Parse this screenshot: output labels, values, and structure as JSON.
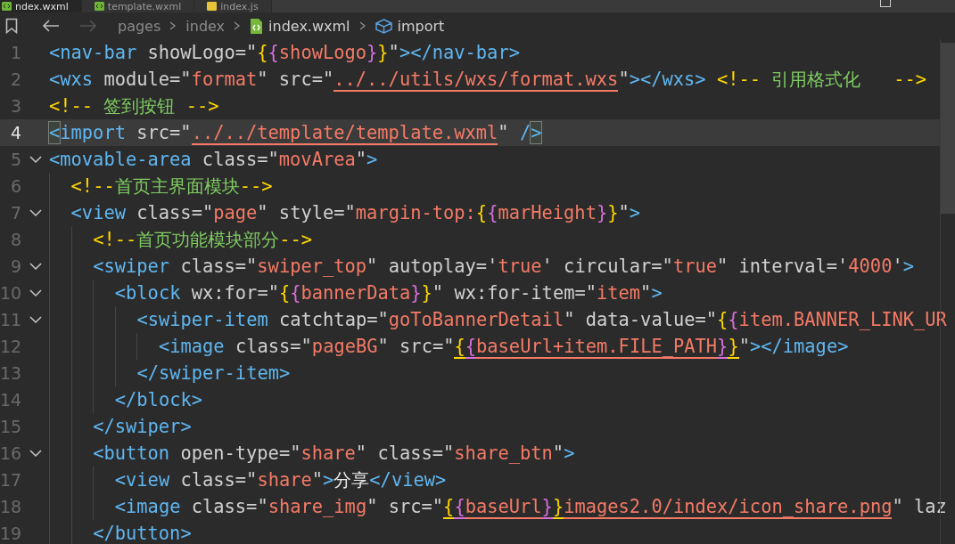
{
  "tabs": [
    {
      "label": "ndex.wxml",
      "kind": "wxml",
      "selected": true
    },
    {
      "label": "template.wxml",
      "kind": "wxml",
      "selected": false
    },
    {
      "label": "index.js",
      "kind": "js",
      "selected": false
    }
  ],
  "breadcrumb": {
    "back_disabled": false,
    "forward_disabled": true,
    "items": [
      {
        "label": "pages",
        "kind": "folder"
      },
      {
        "label": "index",
        "kind": "folder"
      },
      {
        "label": "index.wxml",
        "kind": "file"
      },
      {
        "label": "import",
        "kind": "symbol"
      }
    ]
  },
  "lines": [
    {
      "number": "1",
      "foldable": false,
      "selected": false,
      "tokens": [
        {
          "kind": "tag",
          "text": "<nav-bar"
        },
        {
          "kind": "attr",
          "text": " showLogo=\""
        },
        {
          "kind": "brace1",
          "text": "{"
        },
        {
          "kind": "brace2",
          "text": "{"
        },
        {
          "kind": "string",
          "text": "showLogo"
        },
        {
          "kind": "brace2",
          "text": "}"
        },
        {
          "kind": "brace1",
          "text": "}"
        },
        {
          "kind": "attr",
          "text": "\""
        },
        {
          "kind": "tag",
          "text": "></nav-bar>"
        }
      ]
    },
    {
      "number": "2",
      "foldable": false,
      "selected": false,
      "tokens": [
        {
          "kind": "tag",
          "text": "<wxs"
        },
        {
          "kind": "attr",
          "text": " module=\""
        },
        {
          "kind": "string",
          "text": "format"
        },
        {
          "kind": "attr",
          "text": "\" src=\""
        },
        {
          "kind": "string",
          "text": "../../utils/wxs/format.wxs",
          "underlined": true
        },
        {
          "kind": "attr",
          "text": "\""
        },
        {
          "kind": "tag",
          "text": "></wxs> "
        },
        {
          "kind": "comment_mark",
          "text": "<!--"
        },
        {
          "kind": "comment",
          "text": " 引用格式化   "
        },
        {
          "kind": "comment_mark",
          "text": "-->"
        }
      ]
    },
    {
      "number": "3",
      "foldable": false,
      "selected": false,
      "tokens": [
        {
          "kind": "comment_mark",
          "text": "<!--"
        },
        {
          "kind": "comment",
          "text": " 签到按钮 "
        },
        {
          "kind": "comment_mark",
          "text": "-->"
        }
      ]
    },
    {
      "number": "4",
      "foldable": false,
      "selected": true,
      "tokens": [
        {
          "kind": "tag",
          "text": "<",
          "matched": true
        },
        {
          "kind": "tag",
          "text": "import"
        },
        {
          "kind": "attr",
          "text": " src=\""
        },
        {
          "kind": "string",
          "text": "../../template/template.wxml",
          "underlined": true
        },
        {
          "kind": "attr",
          "text": "\" "
        },
        {
          "kind": "tag",
          "text": "/"
        },
        {
          "kind": "tag",
          "text": ">",
          "matched": true
        }
      ]
    },
    {
      "number": "5",
      "foldable": true,
      "selected": false,
      "tokens": [
        {
          "kind": "tag",
          "text": "<movable-area"
        },
        {
          "kind": "attr",
          "text": " class=\""
        },
        {
          "kind": "string",
          "text": "movArea"
        },
        {
          "kind": "attr",
          "text": "\""
        },
        {
          "kind": "tag",
          "text": ">"
        }
      ]
    },
    {
      "number": "6",
      "foldable": false,
      "selected": false,
      "tokens": [
        {
          "kind": "comment_mark",
          "text": "  <!--"
        },
        {
          "kind": "comment",
          "text": "首页主界面模块"
        },
        {
          "kind": "comment_mark",
          "text": "-->"
        }
      ]
    },
    {
      "number": "7",
      "foldable": true,
      "selected": false,
      "tokens": [
        {
          "kind": "tag",
          "text": "  <view"
        },
        {
          "kind": "attr",
          "text": " class=\""
        },
        {
          "kind": "string",
          "text": "page"
        },
        {
          "kind": "attr",
          "text": "\" style=\""
        },
        {
          "kind": "string",
          "text": "margin-top:"
        },
        {
          "kind": "brace1",
          "text": "{"
        },
        {
          "kind": "brace2",
          "text": "{"
        },
        {
          "kind": "string",
          "text": "marHeight"
        },
        {
          "kind": "brace2",
          "text": "}"
        },
        {
          "kind": "brace1",
          "text": "}"
        },
        {
          "kind": "attr",
          "text": "\""
        },
        {
          "kind": "tag",
          "text": ">"
        }
      ]
    },
    {
      "number": "8",
      "foldable": false,
      "selected": false,
      "tokens": [
        {
          "kind": "comment_mark",
          "text": "    <!--"
        },
        {
          "kind": "comment",
          "text": "首页功能模块部分"
        },
        {
          "kind": "comment_mark",
          "text": "-->"
        }
      ]
    },
    {
      "number": "9",
      "foldable": true,
      "selected": false,
      "tokens": [
        {
          "kind": "tag",
          "text": "    <swiper"
        },
        {
          "kind": "attr",
          "text": " class=\""
        },
        {
          "kind": "string",
          "text": "swiper_top"
        },
        {
          "kind": "attr",
          "text": "\" autoplay='"
        },
        {
          "kind": "string",
          "text": "true"
        },
        {
          "kind": "attr",
          "text": "' circular=\""
        },
        {
          "kind": "string",
          "text": "true"
        },
        {
          "kind": "attr",
          "text": "\" interval='"
        },
        {
          "kind": "string",
          "text": "4000"
        },
        {
          "kind": "attr",
          "text": "'"
        },
        {
          "kind": "tag",
          "text": ">"
        }
      ]
    },
    {
      "number": "10",
      "foldable": true,
      "selected": false,
      "tokens": [
        {
          "kind": "tag",
          "text": "      <block"
        },
        {
          "kind": "attr",
          "text": " wx:for=\""
        },
        {
          "kind": "brace1",
          "text": "{"
        },
        {
          "kind": "brace2",
          "text": "{"
        },
        {
          "kind": "string",
          "text": "bannerData"
        },
        {
          "kind": "brace2",
          "text": "}"
        },
        {
          "kind": "brace1",
          "text": "}"
        },
        {
          "kind": "attr",
          "text": "\" wx:for-item=\""
        },
        {
          "kind": "string",
          "text": "item"
        },
        {
          "kind": "attr",
          "text": "\""
        },
        {
          "kind": "tag",
          "text": ">"
        }
      ]
    },
    {
      "number": "11",
      "foldable": true,
      "selected": false,
      "tokens": [
        {
          "kind": "tag",
          "text": "        <swiper-item"
        },
        {
          "kind": "attr",
          "text": " catchtap=\""
        },
        {
          "kind": "string",
          "text": "goToBannerDetail"
        },
        {
          "kind": "attr",
          "text": "\" data-value=\""
        },
        {
          "kind": "brace1",
          "text": "{"
        },
        {
          "kind": "brace2",
          "text": "{"
        },
        {
          "kind": "string",
          "text": "item.BANNER_LINK_UR"
        }
      ]
    },
    {
      "number": "12",
      "foldable": false,
      "selected": false,
      "tokens": [
        {
          "kind": "tag",
          "text": "          <image"
        },
        {
          "kind": "attr",
          "text": " class=\""
        },
        {
          "kind": "string",
          "text": "pageBG"
        },
        {
          "kind": "attr",
          "text": "\" src=\""
        },
        {
          "kind": "brace1",
          "text": "{",
          "underlined": true
        },
        {
          "kind": "brace2",
          "text": "{",
          "underlined": true
        },
        {
          "kind": "string",
          "text": "baseUrl+item.FILE_PATH",
          "underlined": true
        },
        {
          "kind": "brace2",
          "text": "}",
          "underlined": true
        },
        {
          "kind": "brace1",
          "text": "}",
          "underlined": true
        },
        {
          "kind": "attr",
          "text": "\""
        },
        {
          "kind": "tag",
          "text": "></image>"
        }
      ]
    },
    {
      "number": "13",
      "foldable": false,
      "selected": false,
      "tokens": [
        {
          "kind": "tag",
          "text": "        </swiper-item>"
        }
      ]
    },
    {
      "number": "14",
      "foldable": false,
      "selected": false,
      "tokens": [
        {
          "kind": "tag",
          "text": "      </block>"
        }
      ]
    },
    {
      "number": "15",
      "foldable": false,
      "selected": false,
      "tokens": [
        {
          "kind": "tag",
          "text": "    </swiper>"
        }
      ]
    },
    {
      "number": "16",
      "foldable": true,
      "selected": false,
      "tokens": [
        {
          "kind": "tag",
          "text": "    <button"
        },
        {
          "kind": "attr",
          "text": " open-type=\""
        },
        {
          "kind": "string",
          "text": "share"
        },
        {
          "kind": "attr",
          "text": "\" class=\""
        },
        {
          "kind": "string",
          "text": "share_btn"
        },
        {
          "kind": "attr",
          "text": "\""
        },
        {
          "kind": "tag",
          "text": ">"
        }
      ]
    },
    {
      "number": "17",
      "foldable": false,
      "selected": false,
      "tokens": [
        {
          "kind": "tag",
          "text": "      <view"
        },
        {
          "kind": "attr",
          "text": " class=\""
        },
        {
          "kind": "string",
          "text": "share"
        },
        {
          "kind": "attr",
          "text": "\""
        },
        {
          "kind": "tag",
          "text": ">"
        },
        {
          "kind": "plain",
          "text": "分享"
        },
        {
          "kind": "tag",
          "text": "</view>"
        }
      ]
    },
    {
      "number": "18",
      "foldable": false,
      "selected": false,
      "tokens": [
        {
          "kind": "tag",
          "text": "      <image"
        },
        {
          "kind": "attr",
          "text": " class=\""
        },
        {
          "kind": "string",
          "text": "share_img"
        },
        {
          "kind": "attr",
          "text": "\" src=\""
        },
        {
          "kind": "brace1",
          "text": "{",
          "underlined": true
        },
        {
          "kind": "brace2",
          "text": "{",
          "underlined": true
        },
        {
          "kind": "string",
          "text": "baseUrl",
          "underlined": true
        },
        {
          "kind": "brace2",
          "text": "}",
          "underlined": true
        },
        {
          "kind": "brace1",
          "text": "}",
          "underlined": true
        },
        {
          "kind": "string",
          "text": "images2.0/index/icon_share.png",
          "underlined": true
        },
        {
          "kind": "attr",
          "text": "\" laz"
        }
      ]
    },
    {
      "number": "19",
      "foldable": false,
      "selected": false,
      "tokens": [
        {
          "kind": "tag",
          "text": "    </button>"
        }
      ]
    }
  ]
}
